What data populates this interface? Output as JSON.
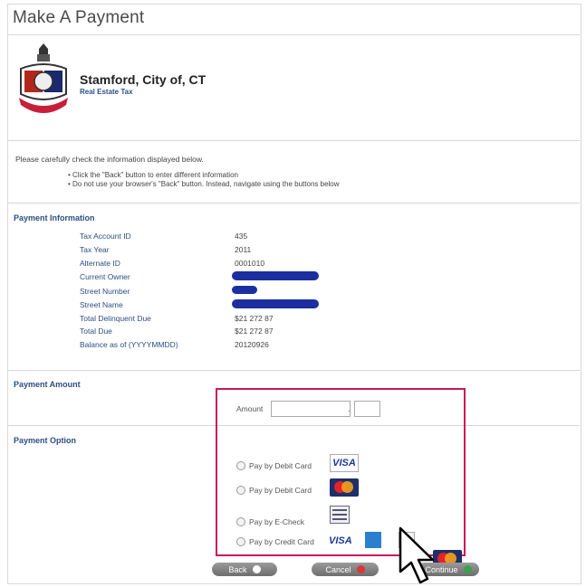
{
  "header": {
    "title": "Make A Payment"
  },
  "org": {
    "name": "Stamford, City of, CT",
    "subtitle": "Real Estate Tax"
  },
  "notice": {
    "intro": "Please carefully check the information displayed below.",
    "bullets": [
      "• Click the \"Back\" button to enter different information",
      "• Do not use your browser's \"Back\" button. Instead, navigate using the buttons below"
    ]
  },
  "payment_info": {
    "heading": "Payment Information",
    "rows": [
      {
        "label": "Tax Account ID",
        "value": "435"
      },
      {
        "label": "Tax Year",
        "value": "2011"
      },
      {
        "label": "Alternate ID",
        "value": "0001010"
      },
      {
        "label": "Current Owner",
        "value": ""
      },
      {
        "label": "Street Number",
        "value": ""
      },
      {
        "label": "Street Name",
        "value": ""
      },
      {
        "label": "Total Delinquent Due",
        "value": "$21 272 87"
      },
      {
        "label": "Total Due",
        "value": "$21 272 87"
      },
      {
        "label": "Balance as of (YYYYMMDD)",
        "value": "20120926"
      }
    ]
  },
  "payment_amount": {
    "heading": "Payment Amount",
    "label": "Amount",
    "dollars": "",
    "separator": ".",
    "cents": ""
  },
  "payment_option": {
    "heading": "Payment Option",
    "options": [
      {
        "label": "Pay by Debit Card",
        "card": "visa",
        "card_text": "VISA"
      },
      {
        "label": "Pay by Debit Card",
        "card": "mastercard"
      },
      {
        "label": "Pay by E-Check",
        "card": "echeck"
      },
      {
        "label": "Pay by Credit Card",
        "card": "visa-amex-discover-mastercard",
        "card_text": "VISA"
      }
    ]
  },
  "buttons": {
    "back": "Back",
    "cancel": "Cancel",
    "continue": "Continue"
  },
  "colors": {
    "accent_border": "#c9175a",
    "section_heading": "#2d4d84",
    "redaction": "#1b2fa0"
  }
}
